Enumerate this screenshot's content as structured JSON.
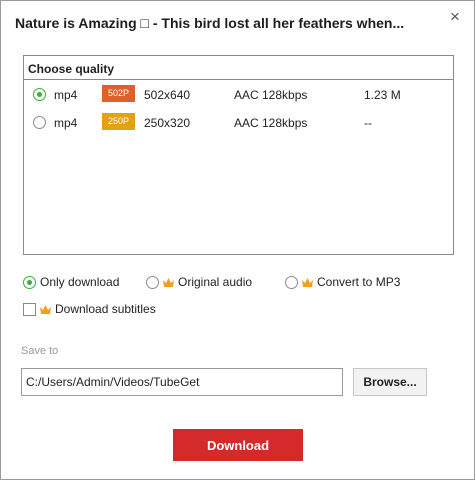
{
  "dialog": {
    "title": "Nature is Amazing □ - This bird lost all her feathers when...",
    "close_glyph": "×"
  },
  "quality": {
    "header": "Choose quality",
    "rows": [
      {
        "format": "mp4",
        "badge": "502P",
        "badge_color": "#e0602a",
        "resolution": "502x640",
        "audio": "AAC 128kbps",
        "size": "1.23 M",
        "selected": true
      },
      {
        "format": "mp4",
        "badge": "250P",
        "badge_color": "#e3a114",
        "resolution": "250x320",
        "audio": "AAC 128kbps",
        "size": "--",
        "selected": false
      }
    ]
  },
  "options": {
    "only_download": "Only download",
    "original_audio": "Original audio",
    "convert_mp3": "Convert to MP3",
    "download_subtitles": "Download subtitles"
  },
  "save": {
    "label": "Save to",
    "path": "C:/Users/Admin/Videos/TubeGet",
    "browse_label": "Browse..."
  },
  "download_label": "Download",
  "colors": {
    "accent_green": "#3cae3c",
    "download_red": "#d42a2a",
    "crown_orange": "#f0a020"
  }
}
